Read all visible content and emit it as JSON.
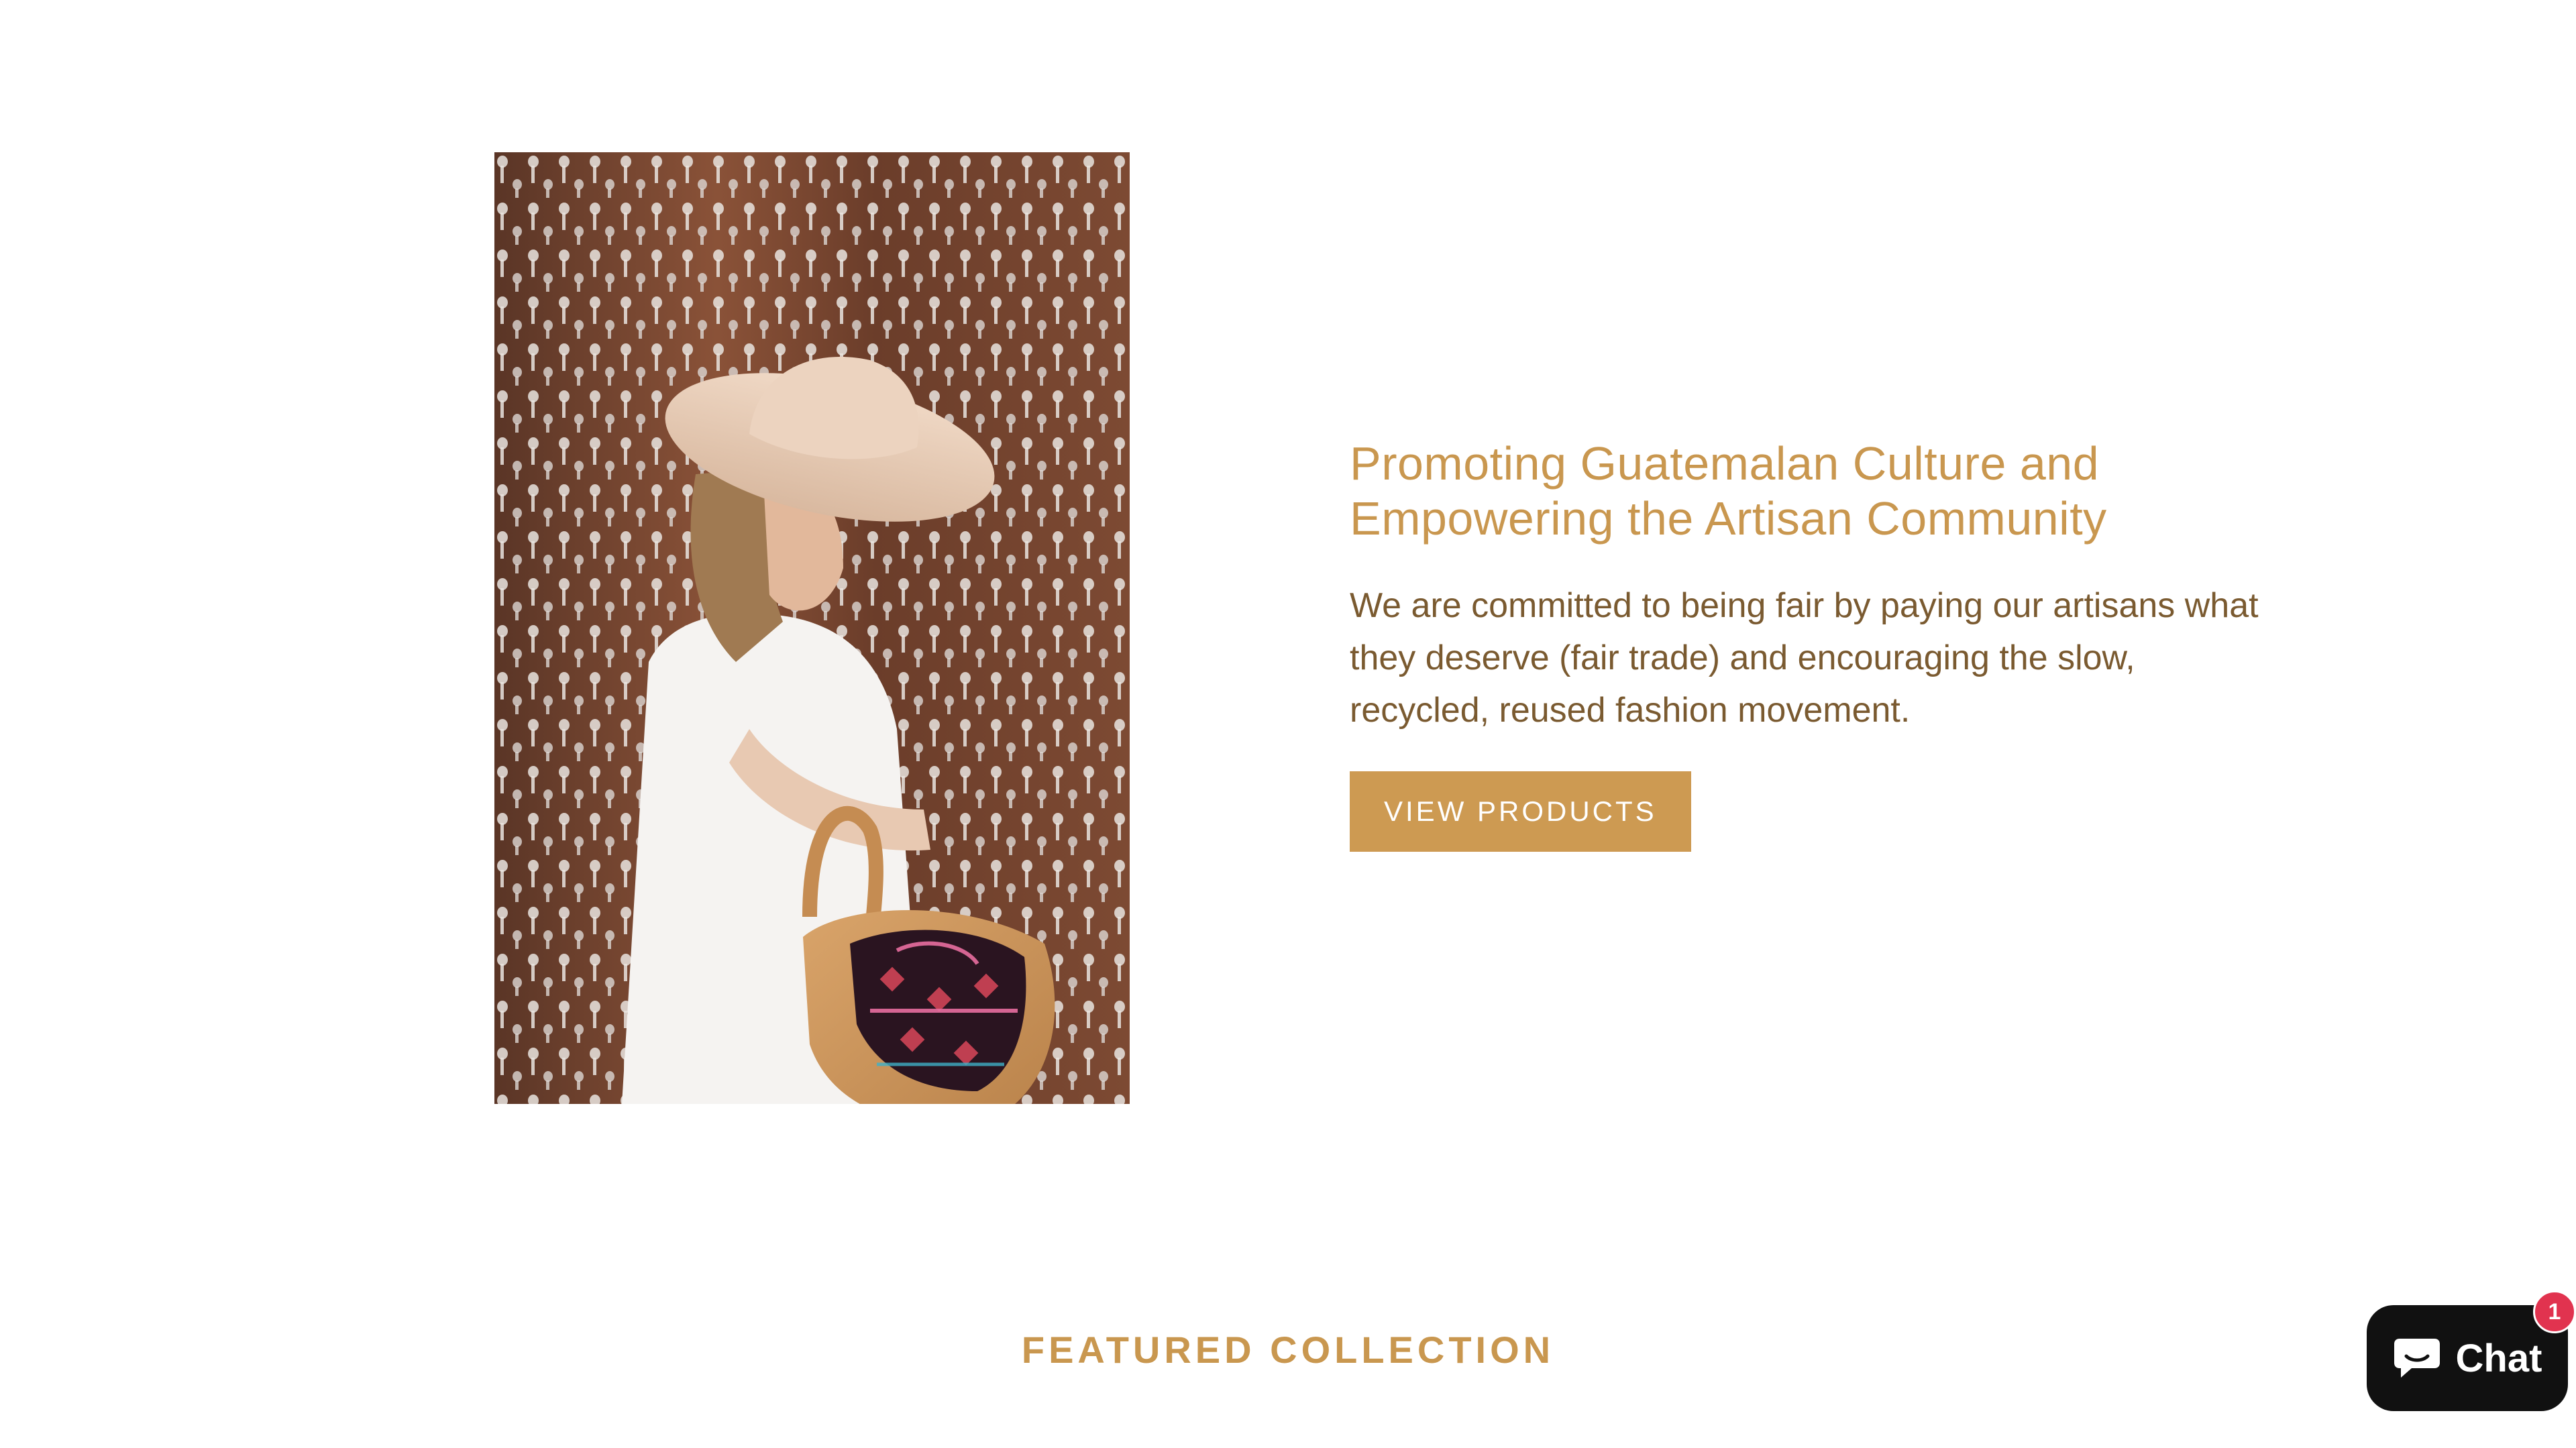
{
  "intro": {
    "heading": "Promoting Guatemalan Culture and Empowering the Artisan Community",
    "body": "We are committed to being fair by paying our artisans what they deserve (fair trade) and encouraging the slow, recycled, reused fashion movement.",
    "cta_label": "VIEW PRODUCTS",
    "image_icon": "photo-woman-with-woven-bag"
  },
  "featured": {
    "title": "FEATURED COLLECTION"
  },
  "chat": {
    "label": "Chat",
    "badge_count": "1",
    "icon": "chat-bubble-icon"
  },
  "colors": {
    "accent": "#cd9a52",
    "heading": "#c9974f",
    "body_text": "#7a5a30",
    "chat_bg": "#111111",
    "badge": "#e1334f"
  }
}
